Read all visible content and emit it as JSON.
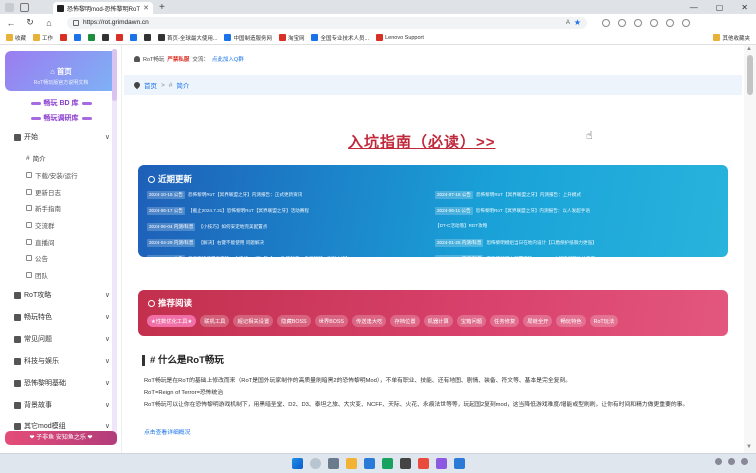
{
  "browser": {
    "tab_title": "恐怖黎明mod-恐怖黎明RoT模组",
    "url": "https://rot.grimdawn.cn",
    "window_controls": [
      "—",
      "▢",
      "✕"
    ],
    "bookmarks": [
      {
        "label": "收藏",
        "icon": "folder"
      },
      {
        "label": "工作",
        "icon": "folder"
      },
      {
        "label": "",
        "icon": "red"
      },
      {
        "label": "",
        "icon": "blue"
      },
      {
        "label": "",
        "icon": "green"
      },
      {
        "label": "",
        "icon": "dark"
      },
      {
        "label": "",
        "icon": "red"
      },
      {
        "label": "",
        "icon": "blue"
      },
      {
        "label": "",
        "icon": "dark"
      },
      {
        "label": "首页-全球最大使用...",
        "icon": "dark"
      },
      {
        "label": "中国制造服务网",
        "icon": "blue"
      },
      {
        "label": "淘宝网",
        "icon": "red"
      },
      {
        "label": "全国专业技术人员...",
        "icon": "blue"
      },
      {
        "label": "Lenovo Support",
        "icon": "red"
      }
    ],
    "bookmarks_right": "其他收藏夹"
  },
  "sidebar": {
    "home_label": "首页",
    "home_sub": "RoT畅玩版官方说明文档",
    "link_bd": "畅玩 BD 库",
    "link_vote": "畅玩调研库",
    "sections": [
      {
        "label": "开始",
        "icon": "send-icon",
        "chev": "∨"
      },
      {
        "label": "RoT攻略",
        "icon": "book-icon",
        "chev": "∨"
      },
      {
        "label": "畅玩特色",
        "icon": "plus-icon",
        "chev": "∨"
      },
      {
        "label": "常见问题",
        "icon": "question-icon",
        "chev": "∨"
      },
      {
        "label": "科技与娱乐",
        "icon": "tools-icon",
        "chev": "∨"
      },
      {
        "label": "恐怖黎明基础",
        "icon": "gear-icon",
        "chev": "∨"
      },
      {
        "label": "背景故事",
        "icon": "book-icon",
        "chev": "∨"
      },
      {
        "label": "其它mod模组",
        "icon": "grid-icon",
        "chev": "∨"
      }
    ],
    "start_items": [
      "简介",
      "下载/安装/运行",
      "更新日志",
      "新手指南",
      "交流群",
      "直播间",
      "公告",
      "团队"
    ],
    "footer": "❤ 子非鱼 安知鱼之乐 ❤"
  },
  "main": {
    "notice_prefix": "RoT畅玩",
    "notice_highlight": "严禁私服",
    "notice_mid": "交流：",
    "notice_link": "点此加入Q群",
    "breadcrumb": [
      "首页",
      ">",
      "#",
      "简介"
    ],
    "guide_link": "入坑指南（必读）>>",
    "recent_title": "近期更新",
    "updates_left": [
      {
        "date": "2024-10-15 公告",
        "text": "恐怖黎明RoT【冥界联盟之牙】内测报告：正式更新资讯"
      },
      {
        "date": "2024-06-17 公告",
        "text": "【截止2024.7.31】恐怖黎明RoT【冥界联盟之牙】活动赛程"
      },
      {
        "date": "2024-06-04 内测/科普",
        "text": "【小技巧】如何安定地完美配置点"
      },
      {
        "date": "2024-04-29 内测/科普",
        "text": "【解决】右键不能使用 问题解决"
      },
      {
        "date": "2024-01-25 公告",
        "text": "新界面特技最高支持10个快捷DC/万1年【RoT攻略科普，多领超越，谢谢之峰】"
      }
    ],
    "updates_right": [
      {
        "date": "2024-07-16 公告",
        "text": "恐怖黎明RoT【冥界联盟之牙】内测报告：上升模式"
      },
      {
        "date": "2024-06-11 公告",
        "text": "恐怖黎明RoT【冥界联盟之牙】内测报告：以人发超手语"
      },
      {
        "date": "",
        "text": "【DT-C活动落】RDT攻略"
      },
      {
        "date": "2024-01-25 内测/科普",
        "text": "恐怖黎明模组当日在地内设计【口盾保护抵御力更强】"
      },
      {
        "date": "2024-01-22 内测/科普",
        "text": "在恐怖黎明中配置支持capture.txt中解决问题仿站内容"
      }
    ],
    "reco_title": "推荐阅读",
    "tags": [
      "★性数优化工具★",
      "联机工具",
      "超记相关设置",
      "隐藏BOSS",
      "世界BOSS",
      "传送逢大吃",
      "存档位置",
      "机器计算",
      "宝箱问题",
      "任务修复",
      "局链全开",
      "畅玩特色",
      "RoT玩法"
    ],
    "section_title": "什么是RoT畅玩",
    "paragraphs": [
      "RoT畅玩是在RoT的基础上修改而来（RoT是国外玩家制作的高质量刷暗黑2的恐怖黎明Mod），不单有职业、技能、还有地图、剧情、装备、符文等、基本是完全复刻。",
      "RoT=Reign of Terror=恐怖统治",
      "RoT畅玩可以让你在恐怖黎明游戏机制下，用黑暗圣堂、D2、D3、泰坦之旅、大灾变、NCFF、天际、火花、永痕法世等等，玩起国2复刻mod，这当降低游戏难度/增能或型刷刷，让你有时间和精力做更重要的事。",
      "点击查看详细概况"
    ]
  }
}
